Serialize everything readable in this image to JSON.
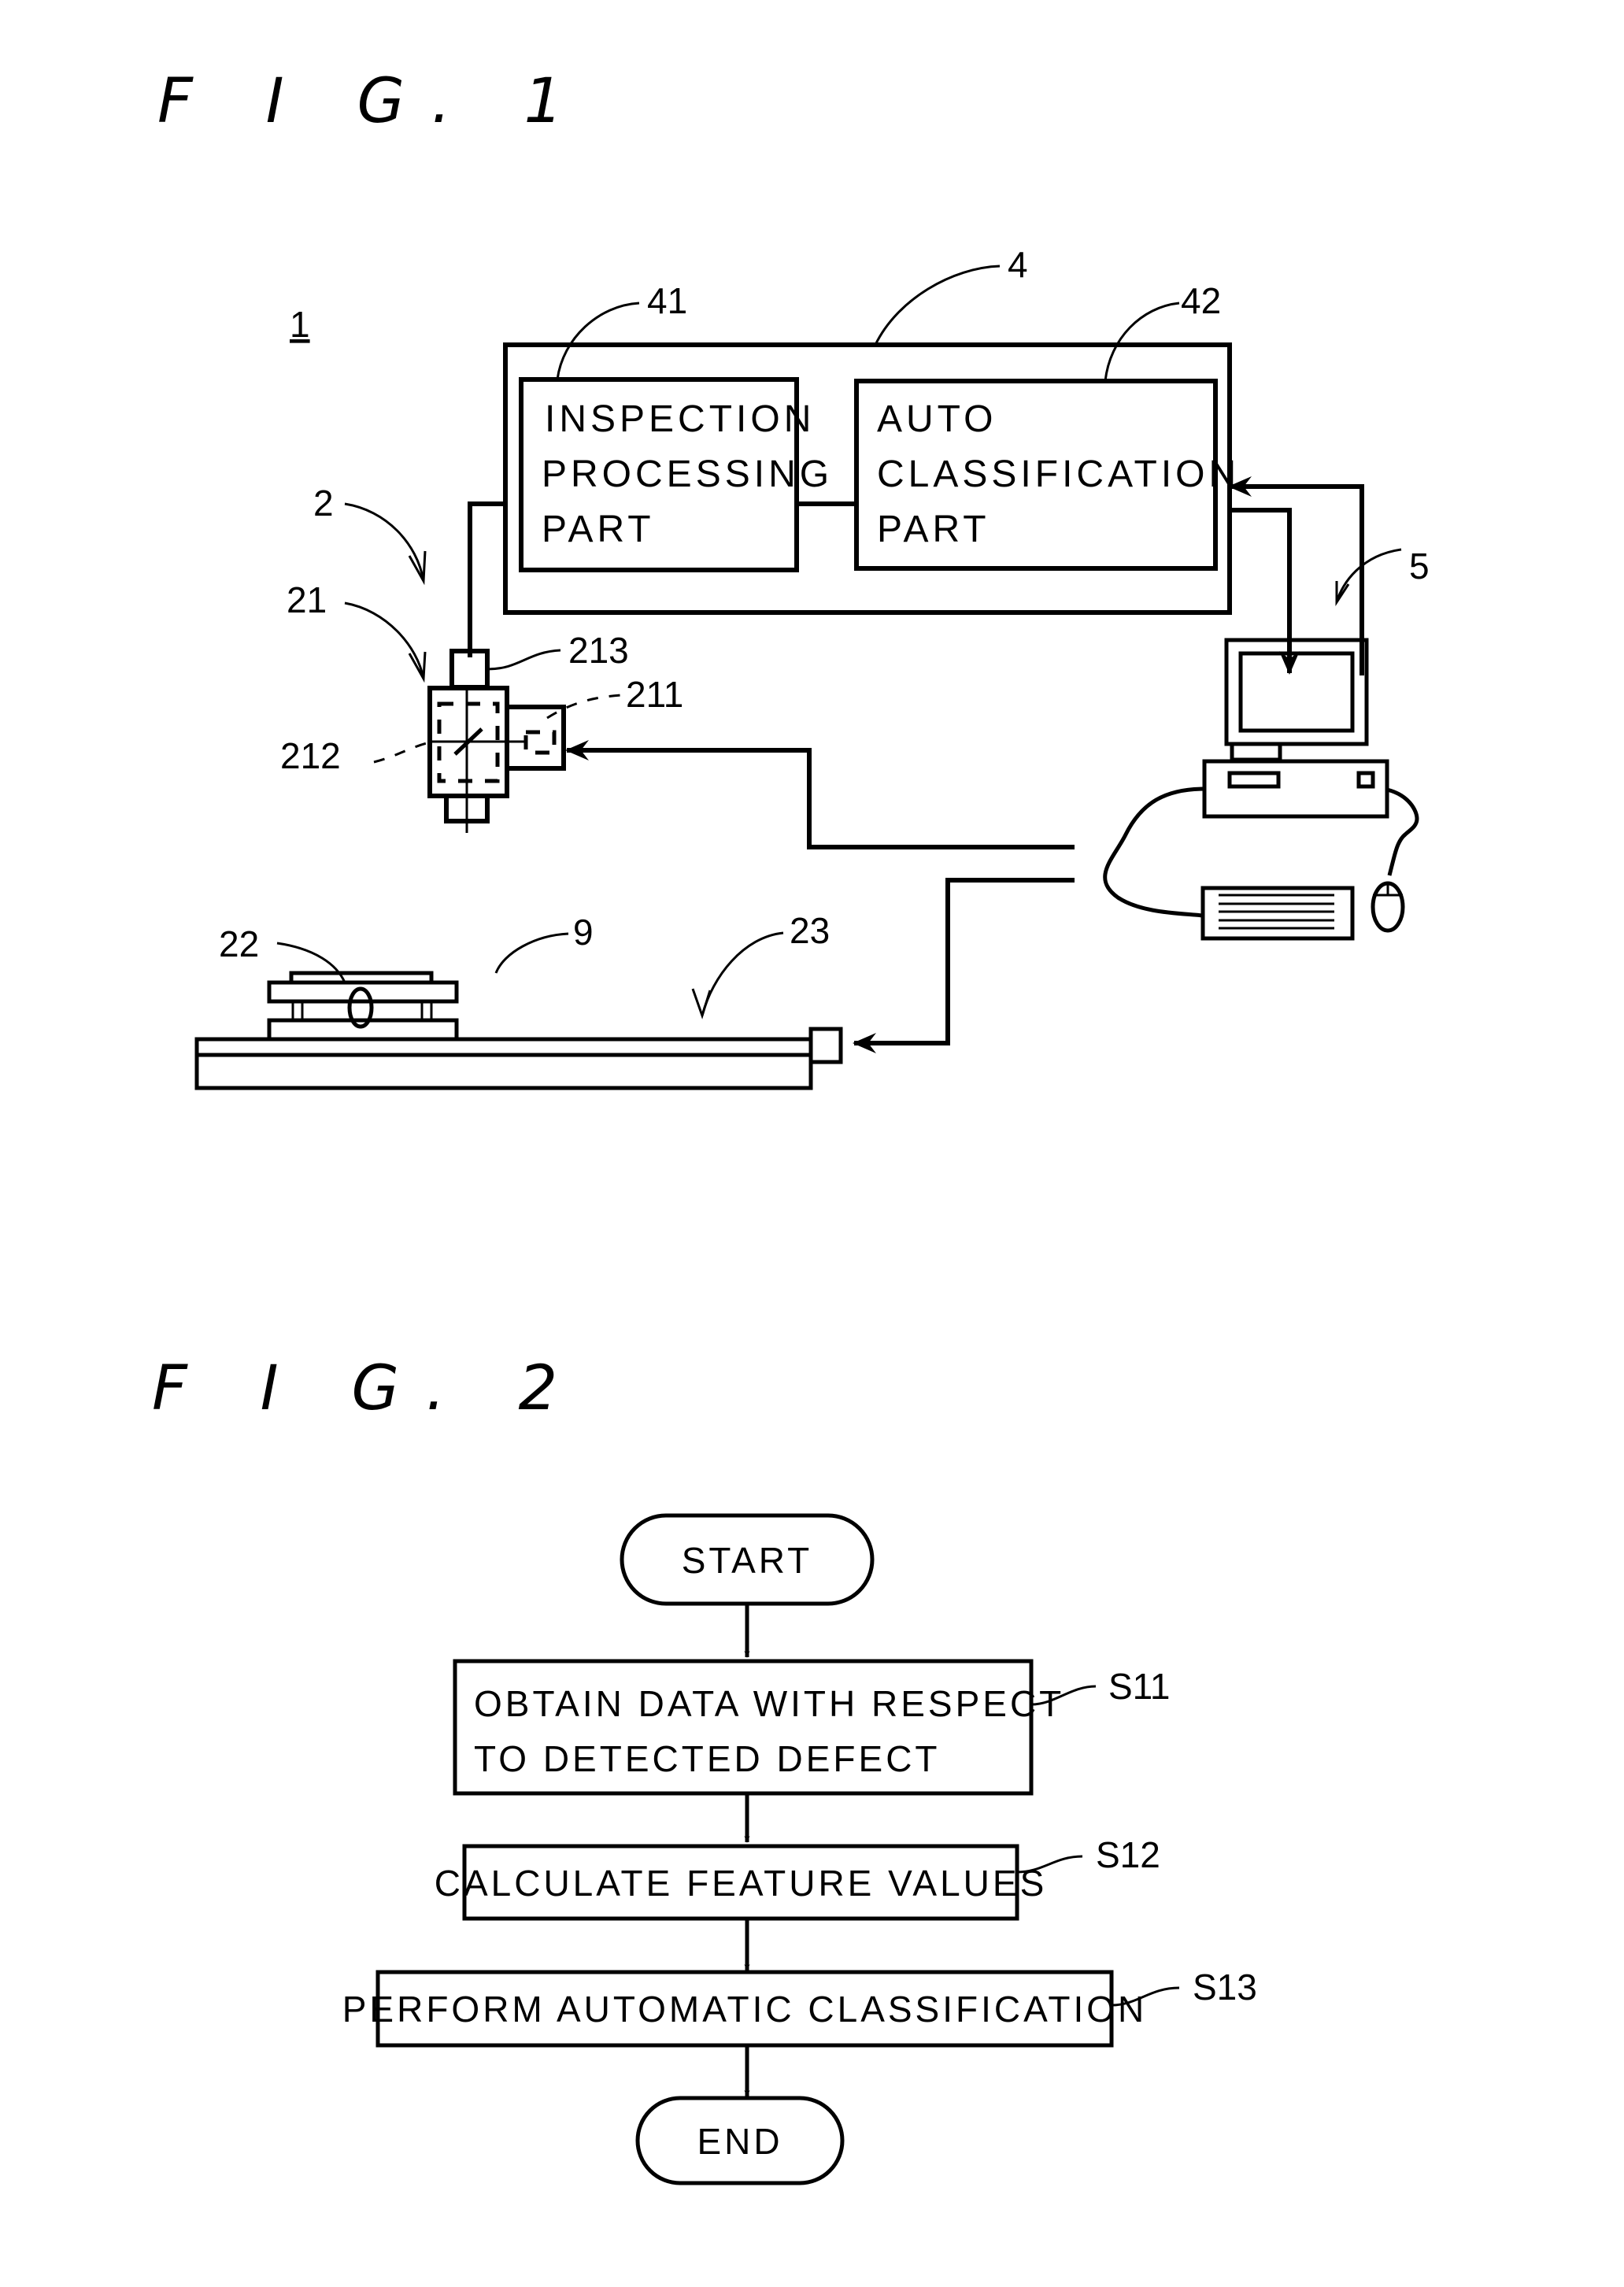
{
  "figure1": {
    "title": "F I G. 1",
    "system_ref": "1",
    "controller": {
      "ref": "4",
      "inspection_part": {
        "ref": "41",
        "lines": [
          "INSPECTION",
          "PROCESSING",
          "PART"
        ]
      },
      "classification_part": {
        "ref": "42",
        "lines": [
          "AUTO",
          "CLASSIFICATION",
          "PART"
        ]
      }
    },
    "imaging_apparatus": {
      "ref": "2",
      "image_pickup_part_ref": "21",
      "light_source_ref": "211",
      "half_mirror_ref": "212",
      "camera_ref": "213"
    },
    "stage": {
      "ref": "22",
      "substrate_ref": "9",
      "stage_driver_ref": "23"
    },
    "computer": {
      "ref": "5"
    }
  },
  "figure2": {
    "title": "F I G. 2",
    "start_label": "START",
    "end_label": "END",
    "steps": [
      {
        "id": "S11",
        "lines": [
          "OBTAIN DATA WITH RESPECT",
          "TO DETECTED DEFECT"
        ]
      },
      {
        "id": "S12",
        "lines": [
          "CALCULATE FEATURE VALUES"
        ]
      },
      {
        "id": "S13",
        "lines": [
          "PERFORM AUTOMATIC CLASSIFICATION"
        ]
      }
    ]
  }
}
